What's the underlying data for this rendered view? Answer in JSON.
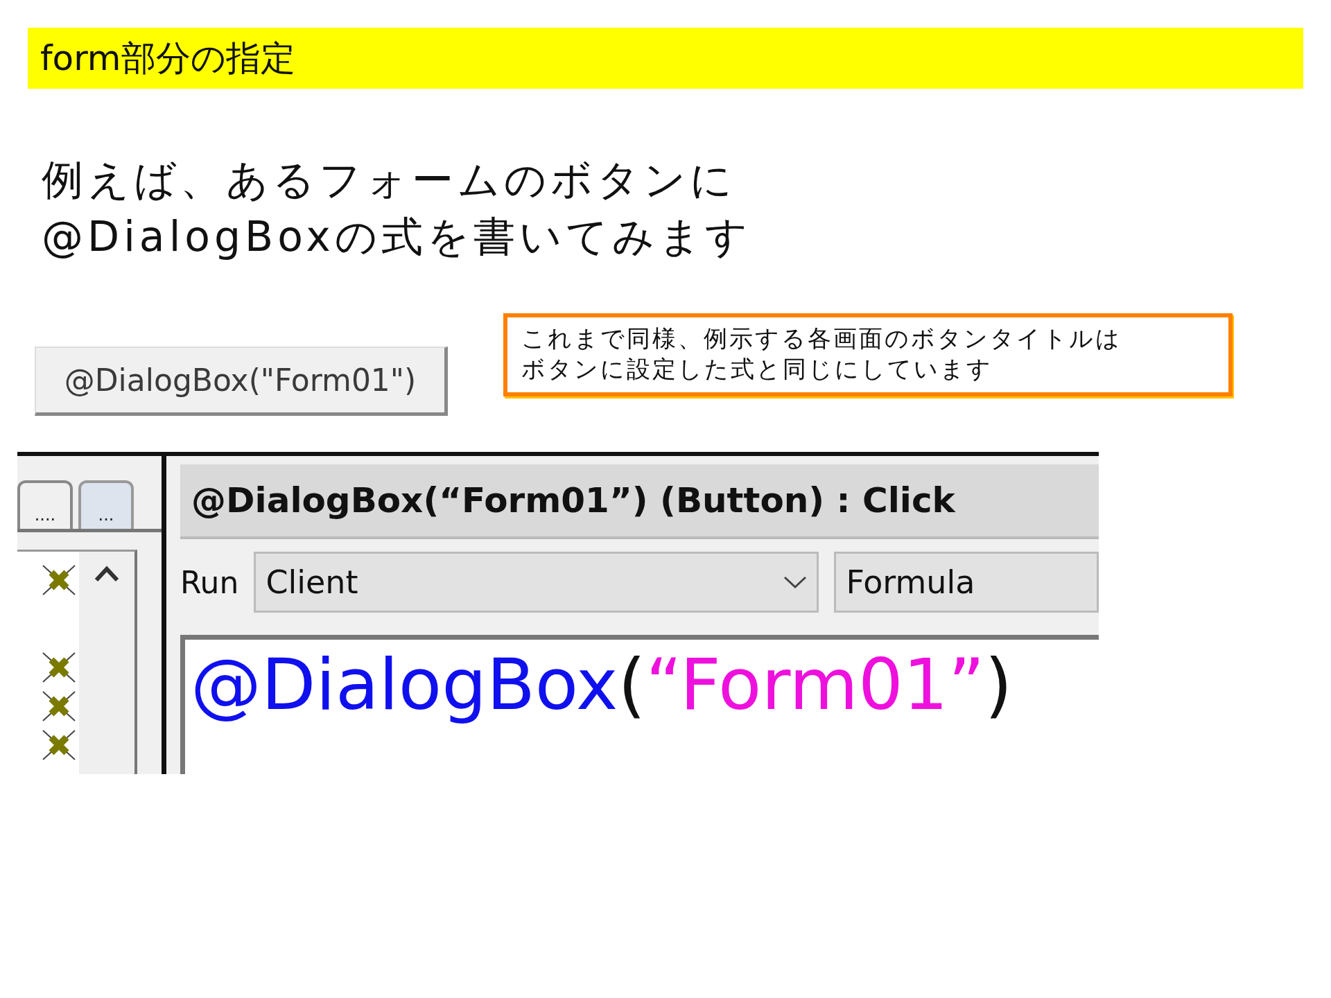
{
  "header": {
    "title": "form部分の指定"
  },
  "intro": {
    "lines": [
      "例えば、あるフォームのボタンに",
      "@DialogBoxの式を書いてみます"
    ]
  },
  "form_button": {
    "label": "@DialogBox(\"Form01\")"
  },
  "note": {
    "lines": [
      "これまで同様、例示する各画面のボタンタイトルは",
      "ボタンに設定した式と同じにしています"
    ]
  },
  "designer": {
    "tabs": [
      {
        "label": "....",
        "selected": false
      },
      {
        "label": "...",
        "selected": true
      }
    ],
    "event_title": "@DialogBox(“Form01”) (Button) : Click",
    "run_label": "Run",
    "run_select": {
      "value": "Client"
    },
    "type_select": {
      "value": "Formula"
    },
    "code": [
      {
        "text": "@DialogBox",
        "kind": "function"
      },
      {
        "text": "(",
        "kind": "punct"
      },
      {
        "text": "“Form01”",
        "kind": "string"
      },
      {
        "text": ")",
        "kind": "punct"
      }
    ]
  }
}
